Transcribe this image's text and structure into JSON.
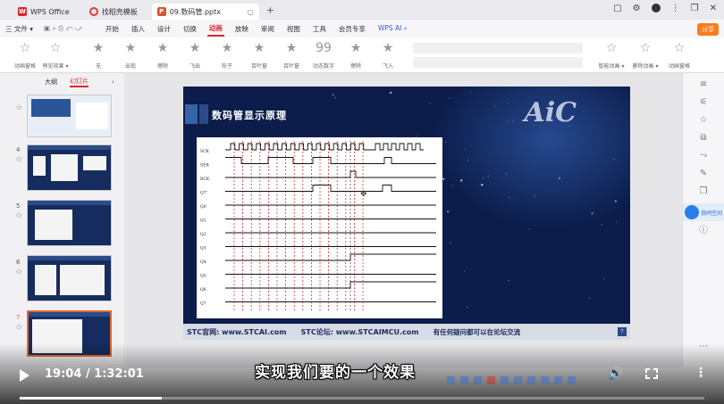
{
  "app": {
    "tabs": [
      {
        "label": "WPS Office"
      },
      {
        "label": "找稻壳模板"
      },
      {
        "label": "09.数码管.pptx"
      }
    ]
  },
  "menubar": {
    "file": "三 文件 ▾",
    "items": [
      "开始",
      "插入",
      "设计",
      "切换",
      "动画",
      "放映",
      "审阅",
      "视图",
      "工具",
      "会员专享"
    ],
    "selected": "动画",
    "wps_ai": "WPS AI",
    "share": "分享"
  },
  "ribbon": {
    "buttons": [
      "动画窗格",
      "预览效果 ▾",
      "无",
      "出现",
      "擦除",
      "飞出",
      "轮子",
      "百叶窗",
      "百叶窗",
      "动态数字",
      "擦除",
      "飞入"
    ],
    "right_buttons": [
      "智能动画 ▾",
      "删除动画 ▾",
      "动画窗格"
    ]
  },
  "left_panel": {
    "tabs": [
      "大纲",
      "幻灯片"
    ],
    "selected_tab": "幻灯片",
    "slide_numbers": [
      "4",
      "5",
      "6",
      "7"
    ]
  },
  "slide": {
    "title": "数码管显示原理",
    "logo": "AiC",
    "footer_official": "STC官网: www.STCAI.com",
    "footer_forum": "STC论坛: www.STCAIMCU.com",
    "footer_question": "有任何疑问都可以在论坛交流",
    "page_num": "7",
    "signals": [
      "SCK",
      "SER",
      "RCK",
      "Q7'",
      "Q0",
      "Q1",
      "Q2",
      "Q3",
      "Q4",
      "Q5",
      "Q6",
      "Q7"
    ]
  },
  "right_rail": {
    "helper": "协同空间"
  },
  "video": {
    "subtitle": "实现我们要的一个效果",
    "current_time": "19:04",
    "duration": "1:32:01",
    "time_display": "19:04 / 1:32:01",
    "progress": 0.207
  }
}
